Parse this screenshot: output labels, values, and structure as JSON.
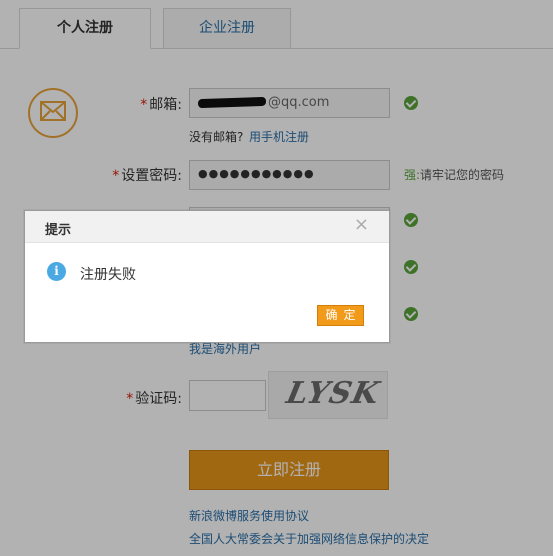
{
  "tabs": {
    "personal": "个人注册",
    "enterprise": "企业注册"
  },
  "form": {
    "email_label": "邮箱:",
    "email_value": "@qq.com",
    "no_email_text": "没有邮箱?",
    "phone_register_link": "用手机注册",
    "password_label": "设置密码:",
    "password_value": "●●●●●●●●●●●",
    "strength_label": "强:",
    "strength_tip": "请牢记您的密码",
    "overseas_link": "我是海外用户",
    "captcha_label": "验证码:",
    "captcha_text": "LYSK",
    "submit_label": "立即注册",
    "terms_link": "新浪微博服务使用协议",
    "law_link": "全国人大常委会关于加强网络信息保护的决定",
    "required_mark": "*"
  },
  "dialog": {
    "title": "提示",
    "close": "×",
    "message": "注册失败",
    "info_glyph": "i",
    "ok_label": "确定"
  },
  "colors": {
    "accent": "#e7951b",
    "link": "#2a6fa8",
    "success": "#5aa43b",
    "info": "#4aa9e3"
  }
}
